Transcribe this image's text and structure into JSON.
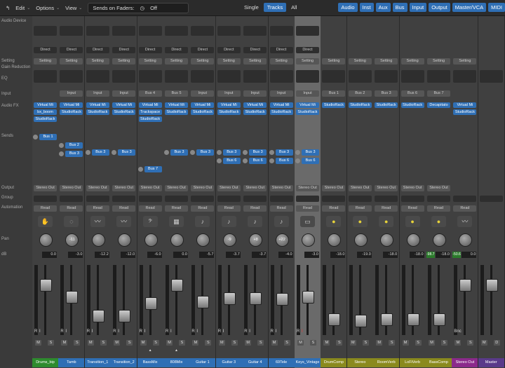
{
  "toolbar": {
    "edit": "Edit",
    "options": "Options",
    "view": "View",
    "sends_on_faders_label": "Sends on Faders:",
    "sends_on_faders_value": "Off",
    "single": "Single",
    "tracks": "Tracks",
    "all": "All",
    "filters": [
      "Audio",
      "Inst",
      "Aux",
      "Bus",
      "Input",
      "Output",
      "Master/VCA",
      "MIDI"
    ]
  },
  "row_labels": {
    "audio_device": "Audio Device",
    "setting": "Setting",
    "gain_reduction": "Gain Reduction",
    "eq": "EQ",
    "input": "Input",
    "audio_fx": "Audio FX",
    "sends": "Sends",
    "output": "Output",
    "group": "Group",
    "automation": "Automation",
    "pan": "Pan",
    "db": "dB"
  },
  "strips": [
    {
      "name": "Drums_bip",
      "color": "#2e8b2e",
      "input": "",
      "fx": [
        "Virtual Mi",
        "bx_boom",
        "StudioRack"
      ],
      "sends": [
        "Bus 1"
      ],
      "output": "Stereo Out",
      "automation": "Read",
      "pan": "",
      "db": "0.0",
      "fader": 0.78,
      "icon": "drum-hand-icon"
    },
    {
      "name": "Tamb",
      "color": "#2f6fb5",
      "input": "Input",
      "fx": [
        "Virtual Mi",
        "StudioRack"
      ],
      "sends": [
        "Bus 2",
        "Bus 3"
      ],
      "output": "Stereo Out",
      "automation": "Read",
      "pan": "-11",
      "db": "-3.0",
      "fader": 0.6,
      "icon": "tambourine-icon"
    },
    {
      "name": "Transition_1",
      "color": "#2f6fb5",
      "input": "Input",
      "fx": [
        "Virtual Mi",
        "StudioRack"
      ],
      "sends": [
        "Bus 3"
      ],
      "output": "Stereo Out",
      "automation": "Read",
      "pan": "",
      "db": "-12.2",
      "fader": 0.3,
      "icon": "waveform-icon"
    },
    {
      "name": "Transition_2",
      "color": "#2f6fb5",
      "input": "Input",
      "fx": [
        "Virtual Mi",
        "StudioRack"
      ],
      "sends": [
        "Bus 3"
      ],
      "output": "Stereo Out",
      "automation": "Read",
      "pan": "",
      "db": "-12.0",
      "fader": 0.3,
      "icon": "waveform-icon"
    },
    {
      "name": "BassMix",
      "color": "#2f6fb5",
      "input": "Bus 4",
      "fx": [
        "Virtual Mi",
        "Trackspace",
        "StudioRack"
      ],
      "sends": [
        "Bus 7"
      ],
      "output": "Stereo Out",
      "automation": "Read",
      "pan": "",
      "db": "-6.0",
      "fader": 0.5,
      "icon": "bass-guitar-icon"
    },
    {
      "name": "808Mix",
      "color": "#2f6fb5",
      "input": "Bus 5",
      "fx": [
        "Virtual Mi",
        "StudioRack"
      ],
      "sends": [
        "Bus 3"
      ],
      "output": "Stereo Out",
      "automation": "Read",
      "pan": "",
      "db": "0.0",
      "fader": 0.78,
      "icon": "drum-machine-icon"
    },
    {
      "name": "Guitar 1",
      "color": "#2f6fb5",
      "input": "Input",
      "fx": [
        "Virtual Mi",
        "StudioRack"
      ],
      "sends": [
        "Bus 3"
      ],
      "output": "Stereo Out",
      "automation": "Read",
      "pan": "",
      "db": "-5.7",
      "fader": 0.52,
      "icon": "guitar-icon"
    },
    {
      "name": "Guitar 3",
      "color": "#2f6fb5",
      "input": "Input",
      "fx": [
        "Virtual Mi",
        "StudioRack"
      ],
      "sends": [
        "Bus 3",
        "Bus 6"
      ],
      "output": "Stereo Out",
      "automation": "Read",
      "pan": "-9",
      "db": "-3.7",
      "fader": 0.58,
      "icon": "guitar-icon"
    },
    {
      "name": "Guitar 4",
      "color": "#2f6fb5",
      "input": "Input",
      "fx": [
        "Virtual Mi",
        "StudioRack"
      ],
      "sends": [
        "Bus 3",
        "Bus 6"
      ],
      "output": "Stereo Out",
      "automation": "Read",
      "pan": "+8",
      "db": "-3.7",
      "fader": 0.58,
      "icon": "guitar-icon"
    },
    {
      "name": "69Tele",
      "color": "#2f6fb5",
      "input": "Input",
      "fx": [
        "Virtual Mi",
        "StudioRack"
      ],
      "sends": [
        "Bus 3",
        "Bus 6"
      ],
      "output": "Stereo Out",
      "automation": "Read",
      "pan": "+22",
      "db": "-4.0",
      "fader": 0.56,
      "icon": "guitar-icon"
    },
    {
      "name": "Keys_Vintage",
      "color": "#2f6fb5",
      "input": "Input",
      "fx": [
        "Virtual Mi",
        "StudioRack"
      ],
      "sends": [
        "Bus 3",
        "Bus 6"
      ],
      "output": "Stereo Out",
      "automation": "Read",
      "pan": "",
      "db": "-3.0",
      "fader": 0.6,
      "icon": "keyboard-icon",
      "selected": true
    },
    {
      "name": "DrumComp",
      "color": "#8a8a1e",
      "input": "Bus 1",
      "fx": [
        "StudioRack"
      ],
      "sends": [],
      "output": "Stereo Out",
      "automation": "Read",
      "pan": "",
      "db": "-18.0",
      "fader": 0.25,
      "icon": "compressor-icon"
    },
    {
      "name": "Stereo",
      "color": "#8a8a1e",
      "input": "Bus 2",
      "fx": [
        "StudioRack"
      ],
      "sends": [],
      "output": "Stereo Out",
      "automation": "Read",
      "pan": "",
      "db": "-19.0",
      "fader": 0.23,
      "icon": "compressor-icon"
    },
    {
      "name": "RoomVerb",
      "color": "#8a8a1e",
      "input": "Bus 3",
      "fx": [
        "StudioRack"
      ],
      "sends": [],
      "output": "Stereo Out",
      "automation": "Read",
      "pan": "",
      "db": "-18.0",
      "fader": 0.25,
      "icon": "compressor-icon"
    },
    {
      "name": "LoFiVerb",
      "color": "#8a8a1e",
      "input": "Bus 6",
      "fx": [
        "StudioRack"
      ],
      "sends": [],
      "output": "Stereo Out",
      "automation": "Read",
      "pan": "",
      "db": "-18.0",
      "fader": 0.25,
      "icon": "compressor-icon"
    },
    {
      "name": "BassComp",
      "color": "#8a8a1e",
      "input": "Bus 7",
      "fx": [
        "Decapitato"
      ],
      "sends": [],
      "output": "Stereo Out",
      "automation": "Read",
      "pan": "",
      "db": "-18.0",
      "fader": 0.25,
      "icon": "compressor-icon",
      "peak": "-98.7"
    },
    {
      "name": "Stereo Out",
      "color": "#8b2a8b",
      "input": "",
      "fx": [
        "Virtual Mi",
        "StudioRack"
      ],
      "sends": [],
      "output": "",
      "automation": "Read",
      "pan": "",
      "db": "0.0",
      "fader": 0.78,
      "icon": "waveform-icon",
      "peak": "-50.6",
      "bnc": "Bnc"
    },
    {
      "name": "Master",
      "color": "#5a3a8a",
      "input": "",
      "fx": [],
      "sends": [],
      "output": "",
      "automation": "",
      "pan": "",
      "db": "",
      "fader": 0.78,
      "icon": ""
    }
  ],
  "misc": {
    "direct": "Direct",
    "setting_cell": "Setting",
    "r": "R",
    "i": "I",
    "m": "M",
    "s": "S",
    "d": "D"
  }
}
